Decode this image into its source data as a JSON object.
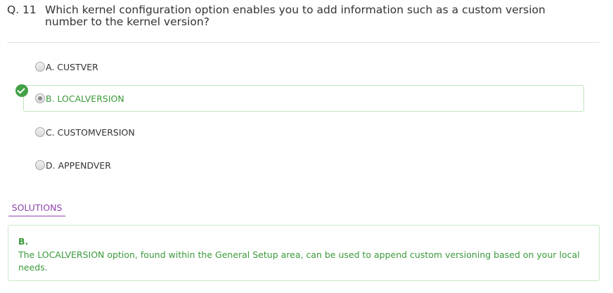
{
  "question": {
    "number": "Q. 11",
    "text": "Which kernel configuration option enables you to add information such as a custom version number to the kernel version?"
  },
  "options": [
    {
      "label": "A. CUSTVER"
    },
    {
      "label": "B. LOCALVERSION"
    },
    {
      "label": "C. CUSTOMVERSION"
    },
    {
      "label": "D. APPENDVER"
    }
  ],
  "selected_option": "B",
  "correct_option": "B",
  "solutions": {
    "tab_label": "SOLUTIONS",
    "answer": "B.",
    "explanation": "The LOCALVERSION option, found within the General Setup area, can be used to append custom versioning based on your local needs."
  },
  "colors": {
    "correct": "#3a9a3a",
    "check_badge": "#43a047",
    "solutions_tab": "#8e44ad",
    "text": "#333333"
  }
}
